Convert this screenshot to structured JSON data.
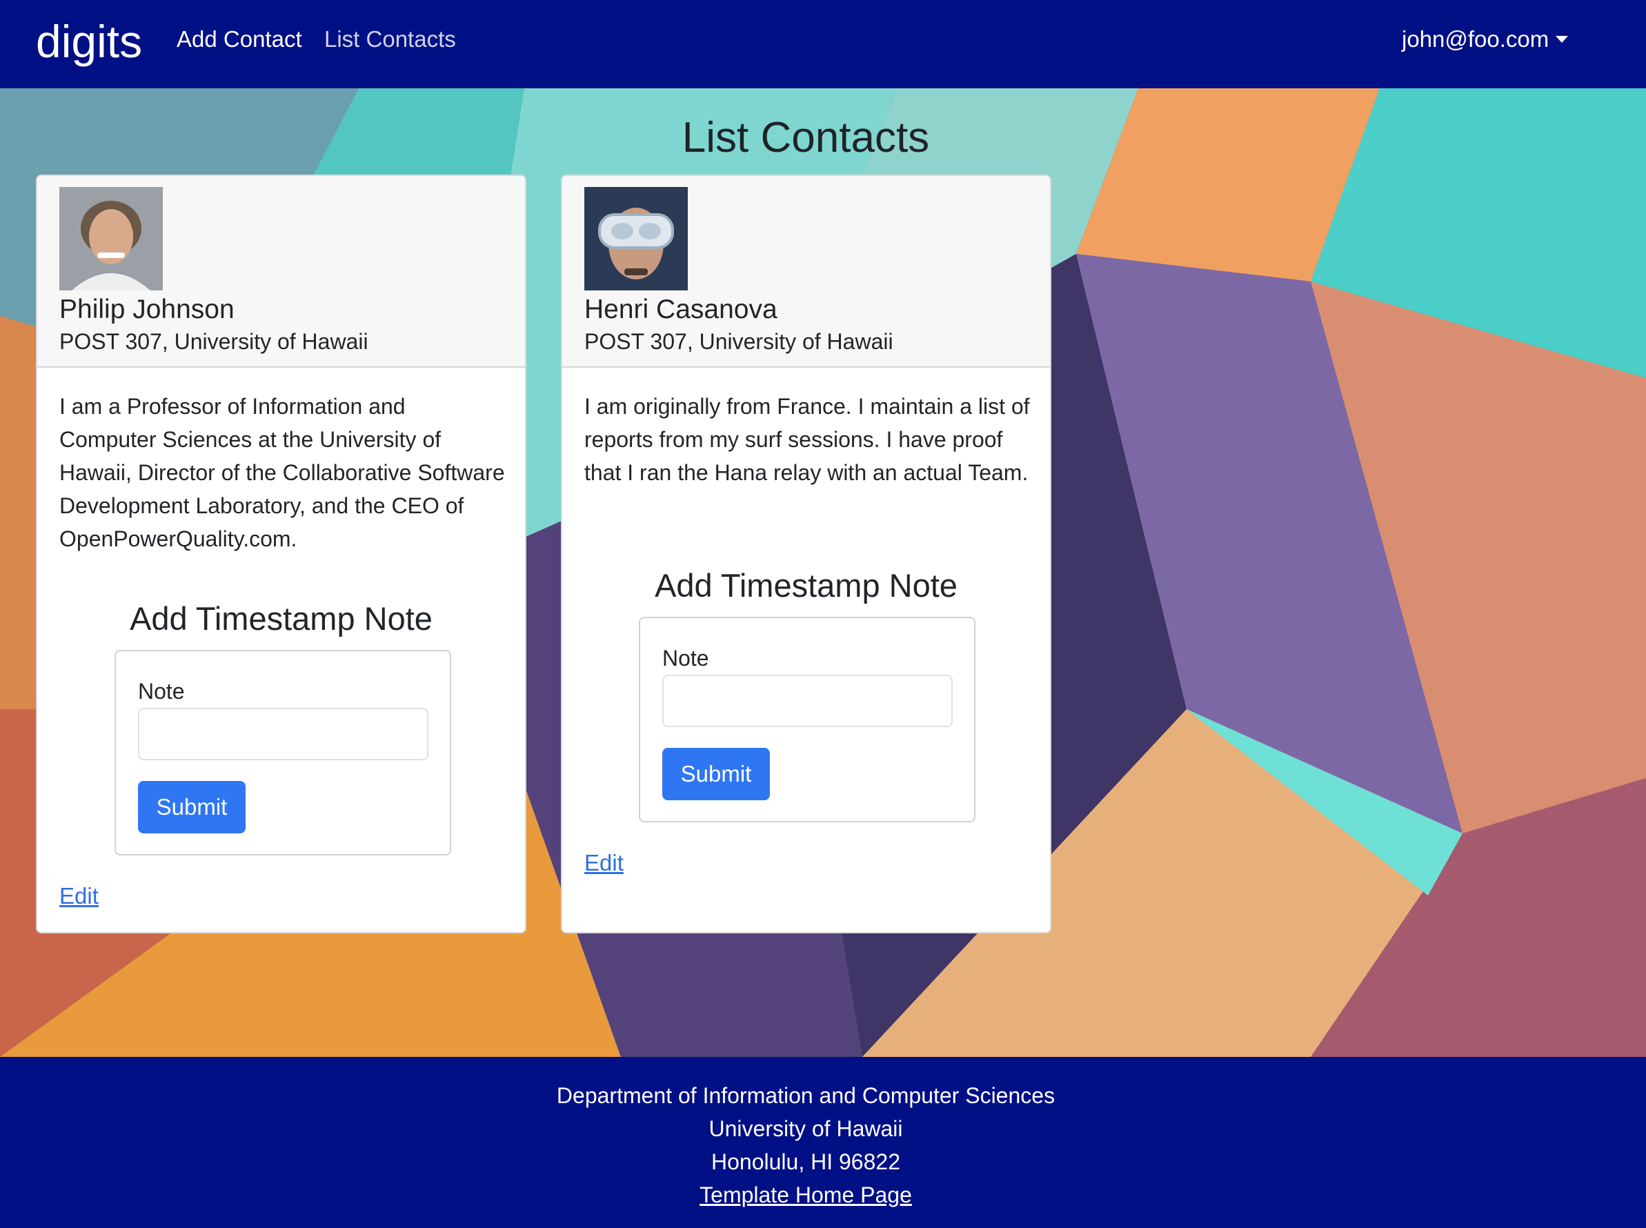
{
  "navbar": {
    "brand": "digits",
    "links": [
      {
        "label": "Add Contact"
      },
      {
        "label": "List Contacts"
      }
    ],
    "user": "john@foo.com"
  },
  "page": {
    "title": "List Contacts"
  },
  "contacts": [
    {
      "name": "Philip Johnson",
      "location": "POST 307, University of Hawaii",
      "description": "I am a Professor of Information and Computer Sciences at the University of Hawaii, Director of the Collaborative Software Development Laboratory, and the CEO of OpenPowerQuality.com.",
      "note_title": "Add Timestamp Note",
      "note_label": "Note",
      "note_value": "",
      "submit_label": "Submit",
      "edit_label": "Edit"
    },
    {
      "name": "Henri Casanova",
      "location": "POST 307, University of Hawaii",
      "description": "I am originally from France. I maintain a list of reports from my surf sessions. I have proof that I ran the Hana relay with an actual Team.",
      "note_title": "Add Timestamp Note",
      "note_label": "Note",
      "note_value": "",
      "submit_label": "Submit",
      "edit_label": "Edit"
    }
  ],
  "footer": {
    "line1": "Department of Information and Computer Sciences",
    "line2": "University of Hawaii",
    "line3": "Honolulu, HI 96822",
    "link": "Template Home Page"
  },
  "colors": {
    "navbar": "#021085",
    "primary_button": "#2f76f3",
    "link": "#2f6fdf"
  }
}
